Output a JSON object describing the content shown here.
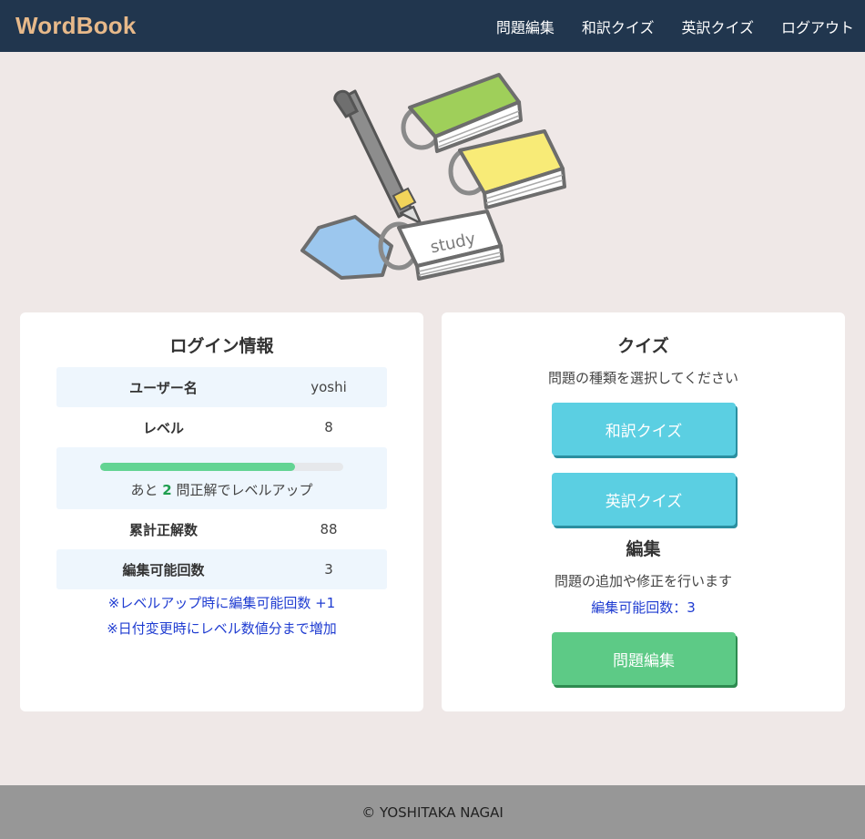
{
  "navbar": {
    "brand": "WordBook",
    "links": [
      "問題編集",
      "和訳クイズ",
      "英訳クイズ",
      "ログアウト"
    ]
  },
  "hero": {
    "study_label": "study"
  },
  "login_info": {
    "title": "ログイン情報",
    "username_label": "ユーザー名",
    "username": "yoshi",
    "level_label": "レベル",
    "level": "8",
    "progress": {
      "fraction": 0.8,
      "prefix": "あと ",
      "remaining": "2",
      "suffix": " 問正解でレベルアップ"
    },
    "correct_label": "累計正解数",
    "correct": "88",
    "edit_label": "編集可能回数",
    "edit": "3",
    "notes": [
      "※レベルアップ時に編集可能回数 +1",
      "※日付変更時にレベル数値分まで増加"
    ]
  },
  "quiz": {
    "title": "クイズ",
    "subtitle": "問題の種類を選択してください",
    "button_ja": "和訳クイズ",
    "button_en": "英訳クイズ"
  },
  "edit": {
    "title": "編集",
    "subtitle": "問題の追加や修正を行います",
    "count_text": "編集可能回数：3",
    "button": "問題編集"
  },
  "footer": {
    "text": "© YOSHITAKA NAGAI"
  }
}
